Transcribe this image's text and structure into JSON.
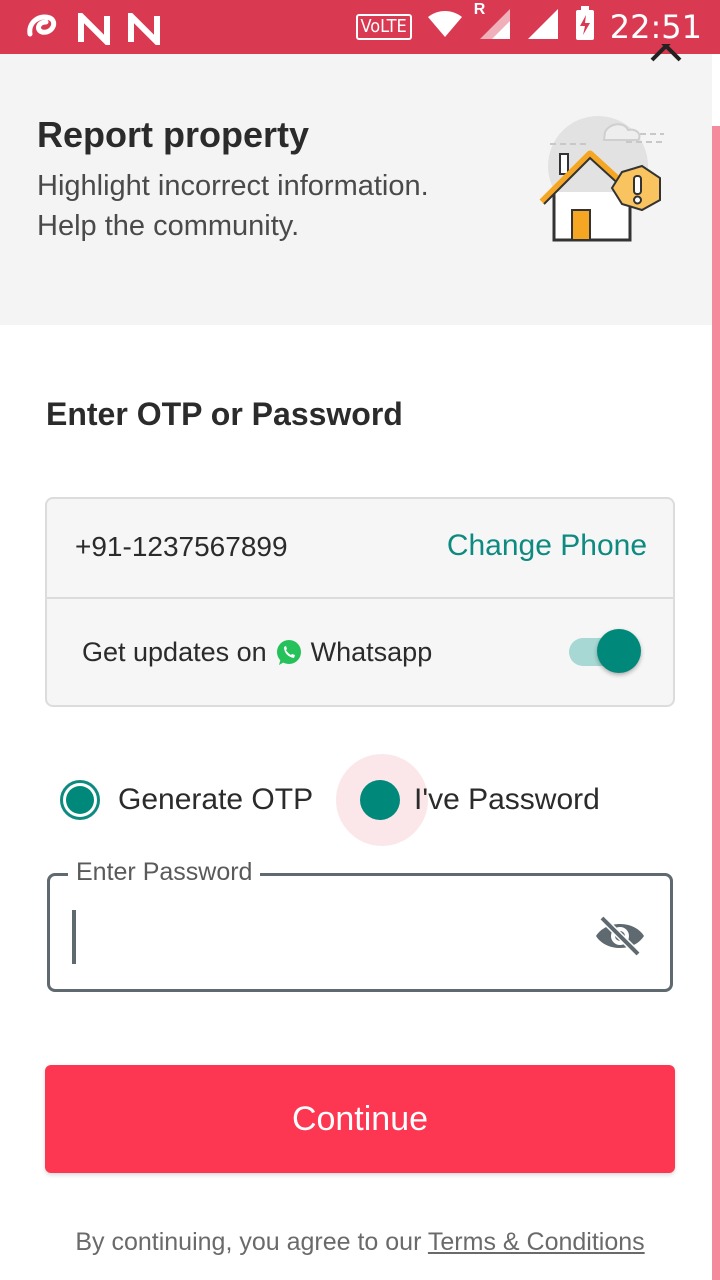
{
  "status_bar": {
    "time": "22:51",
    "volte": "VoLTE",
    "roaming": "R"
  },
  "header": {
    "title": "Report property",
    "subtitle_line1": "Highlight incorrect information.",
    "subtitle_line2": "Help the community."
  },
  "form": {
    "section_title": "Enter OTP or Password",
    "phone_number": "+91-1237567899",
    "change_phone_label": "Change Phone",
    "whatsapp_prefix": "Get updates on",
    "whatsapp_label": "Whatsapp",
    "whatsapp_enabled": true,
    "radio_options": [
      "Generate OTP",
      "I've Password"
    ],
    "selected_option": "I've Password",
    "password_label": "Enter Password",
    "password_value": "",
    "continue_label": "Continue"
  },
  "footer": {
    "terms_prefix": "By continuing, you agree to our",
    "terms_link": "Terms & Conditions"
  },
  "colors": {
    "status_bar": "#d93a52",
    "accent_teal": "#00897b",
    "primary_button": "#fd3752",
    "header_bg": "#f4f4f4"
  }
}
